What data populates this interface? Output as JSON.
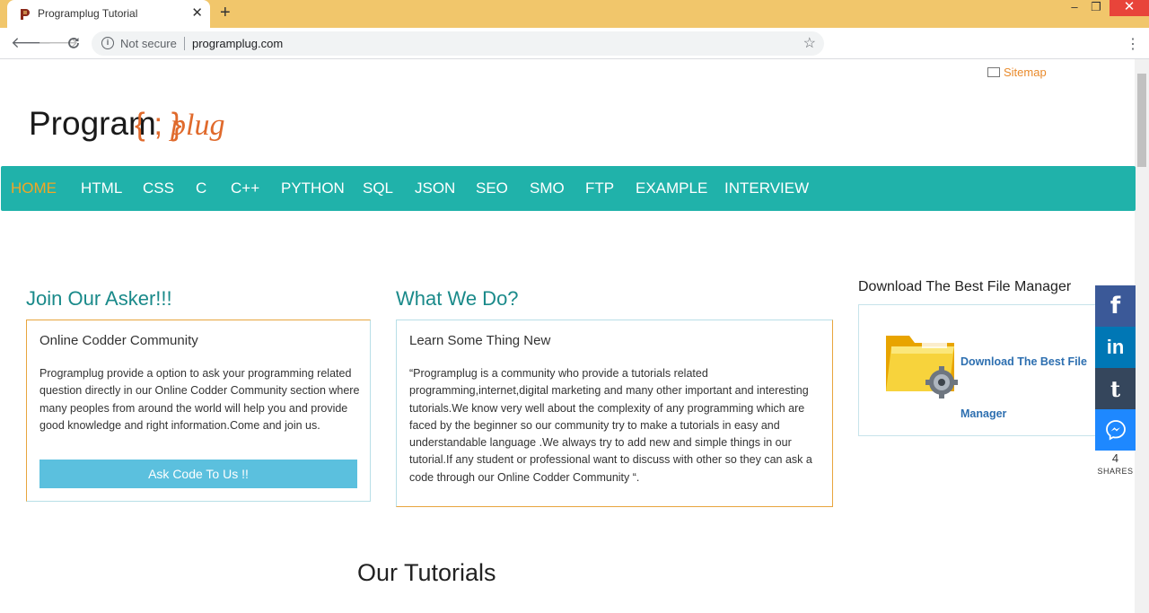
{
  "browser": {
    "tab_title": "Programplug Tutorial",
    "tab_close": "✕",
    "new_tab": "+",
    "security_label": "Not secure",
    "url": "programplug.com",
    "window": {
      "minimize": "–",
      "maximize": "❐",
      "close": "✕"
    }
  },
  "header": {
    "sitemap_label": "Sitemap",
    "logo": {
      "part1": "Program",
      "part2": "{ ; }",
      "part3": "plug"
    }
  },
  "nav": {
    "items": [
      "HOME",
      "HTML",
      "CSS",
      "C",
      "C++",
      "PYTHON",
      "SQL",
      "JSON",
      "SEO",
      "SMO",
      "FTP",
      "EXAMPLE",
      "INTERVIEW"
    ],
    "active": "HOME"
  },
  "join": {
    "heading": "Join Our Asker!!!",
    "box_title": "Online Codder Community",
    "body": "Programplug provide a option to ask your programming related question directly in our Online Codder Community section where many peoples from around the world will help you and provide good knowledge and right information.Come and join us.",
    "button": "Ask Code To Us !!"
  },
  "what": {
    "heading": "What We Do?",
    "box_title": "Learn Some Thing New",
    "body": "“Programplug is a community who provide a tutorials related programming,internet,digital marketing and many other important and interesting tutorials.We know very well about the complexity of any programming which are faced by the beginner so our community try to make a tutorials in easy and understandable language .We always try to add new and simple things in our tutorial.If any student or professional want to discuss with other so they can ask a code through our Online Codder Community “."
  },
  "sidebar": {
    "title": "Download The Best File Manager",
    "link_line1": "Download The Best File",
    "link_line2": "Manager"
  },
  "tutorials_heading": "Our Tutorials",
  "share": {
    "count": "4",
    "label": "SHARES",
    "icons": [
      "facebook-icon",
      "linkedin-icon",
      "tumblr-icon",
      "messenger-icon"
    ]
  },
  "colors": {
    "nav_bg": "#20b2aa",
    "nav_active": "#f2a624",
    "heading": "#1a8a8a",
    "button": "#5bc0de",
    "titlebar": "#f1c66b"
  }
}
